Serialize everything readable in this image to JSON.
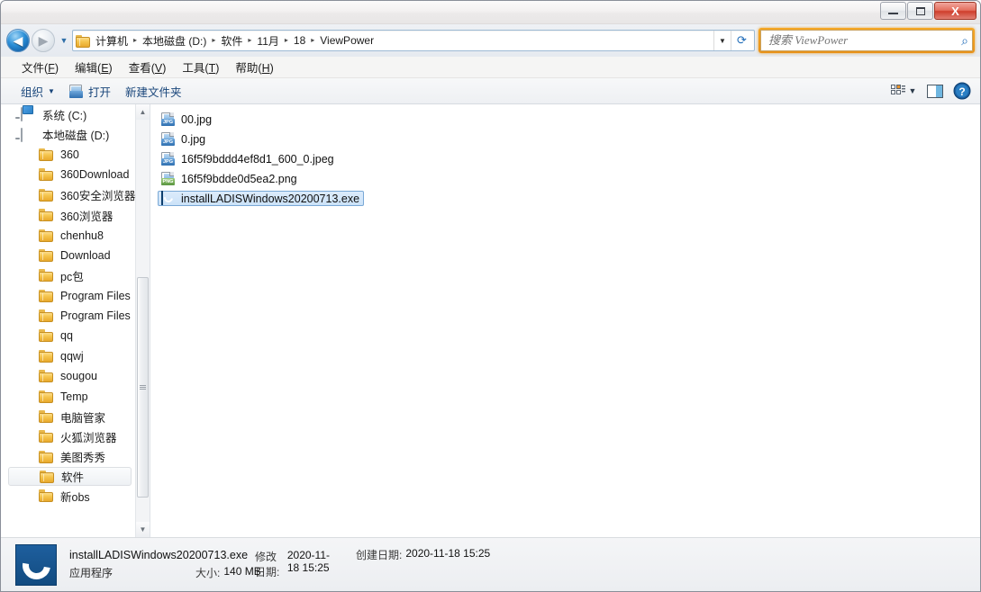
{
  "window": {
    "controls": {
      "minimize": "–",
      "maximize": "□",
      "close": "X"
    }
  },
  "nav": {
    "back_arrow": "◀",
    "forward_arrow": "▶",
    "recent_dropdown": "▼",
    "address_dropdown": "▼",
    "refresh_icon": "⟳",
    "breadcrumbs": [
      {
        "label": "计算机",
        "sep": "▸"
      },
      {
        "label": "本地磁盘 (D:)",
        "sep": "▸"
      },
      {
        "label": "软件",
        "sep": "▸"
      },
      {
        "label": "11月",
        "sep": "▸"
      },
      {
        "label": "18",
        "sep": "▸"
      },
      {
        "label": "ViewPower",
        "sep": ""
      }
    ]
  },
  "search": {
    "placeholder": "搜索 ViewPower",
    "value": "",
    "icon": "search-icon",
    "glyph": "⌕"
  },
  "menu": {
    "items": [
      {
        "text": "文件",
        "accel": "F"
      },
      {
        "text": "编辑",
        "accel": "E"
      },
      {
        "text": "查看",
        "accel": "V"
      },
      {
        "text": "工具",
        "accel": "T"
      },
      {
        "text": "帮助",
        "accel": "H"
      }
    ]
  },
  "toolbar": {
    "organize": "组织",
    "organize_caret": "▼",
    "open": "打开",
    "new_folder": "新建文件夹",
    "view_caret": "▼",
    "help_glyph": "?"
  },
  "sidebar": {
    "items": [
      {
        "label": "系统 (C:)",
        "icon": "drive-system-icon",
        "level": 1,
        "selected": false
      },
      {
        "label": "本地磁盘 (D:)",
        "icon": "drive-icon",
        "level": 1,
        "selected": false
      },
      {
        "label": "360",
        "icon": "folder-icon",
        "level": 2,
        "selected": false
      },
      {
        "label": "360Download",
        "icon": "folder-icon",
        "level": 2,
        "selected": false
      },
      {
        "label": "360安全浏览器",
        "icon": "folder-icon",
        "level": 2,
        "selected": false
      },
      {
        "label": "360浏览器",
        "icon": "folder-icon",
        "level": 2,
        "selected": false
      },
      {
        "label": "chenhu8",
        "icon": "folder-icon",
        "level": 2,
        "selected": false
      },
      {
        "label": "Download",
        "icon": "folder-icon",
        "level": 2,
        "selected": false
      },
      {
        "label": "pc包",
        "icon": "folder-icon",
        "level": 2,
        "selected": false
      },
      {
        "label": "Program Files",
        "icon": "folder-icon",
        "level": 2,
        "selected": false
      },
      {
        "label": "Program Files",
        "icon": "folder-icon",
        "level": 2,
        "selected": false
      },
      {
        "label": "qq",
        "icon": "folder-icon",
        "level": 2,
        "selected": false
      },
      {
        "label": "qqwj",
        "icon": "folder-icon",
        "level": 2,
        "selected": false
      },
      {
        "label": "sougou",
        "icon": "folder-icon",
        "level": 2,
        "selected": false
      },
      {
        "label": "Temp",
        "icon": "folder-icon",
        "level": 2,
        "selected": false
      },
      {
        "label": "电脑管家",
        "icon": "folder-icon",
        "level": 2,
        "selected": false
      },
      {
        "label": "火狐浏览器",
        "icon": "folder-icon",
        "level": 2,
        "selected": false
      },
      {
        "label": "美图秀秀",
        "icon": "folder-icon",
        "level": 2,
        "selected": false
      },
      {
        "label": "软件",
        "icon": "folder-icon",
        "level": 2,
        "selected": true
      },
      {
        "label": "新obs",
        "icon": "folder-icon",
        "level": 2,
        "selected": false
      }
    ],
    "scroll_up": "▲",
    "scroll_down": "▼"
  },
  "files": [
    {
      "name": "00.jpg",
      "type": "jpg",
      "selected": false
    },
    {
      "name": "0.jpg",
      "type": "jpg",
      "selected": false
    },
    {
      "name": "16f5f9bddd4ef8d1_600_0.jpeg",
      "type": "jpg",
      "selected": false
    },
    {
      "name": "16f5f9bdde0d5ea2.png",
      "type": "png",
      "selected": false
    },
    {
      "name": "installLADISWindows20200713.exe",
      "type": "exe",
      "selected": true
    }
  ],
  "icon_labels": {
    "jpg": "JPG",
    "png": "PNG"
  },
  "details": {
    "filename": "installLADISWindows20200713.exe",
    "modified_label": "修改日期:",
    "modified_value": "2020-11-18 15:25",
    "created_label": "创建日期:",
    "created_value": "2020-11-18 15:25",
    "type": "应用程序",
    "size_label": "大小:",
    "size_value": "140 MB"
  },
  "colors": {
    "accent_blue": "#1e6bb8",
    "search_focus": "#f5a623",
    "selection": "#cbe2f8",
    "close_red": "#cf3f2c"
  }
}
